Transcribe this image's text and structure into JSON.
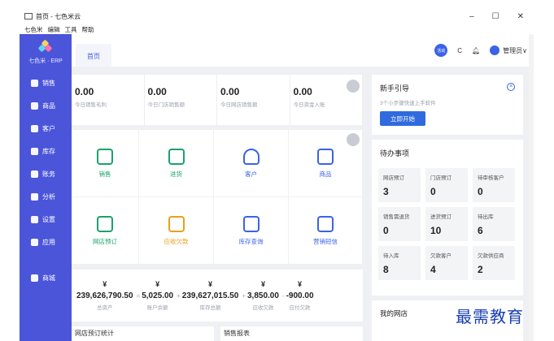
{
  "window": {
    "title": "首页 - 七色米云",
    "minimize": "–",
    "maximize": "☐",
    "close": "✕"
  },
  "menu": [
    "七色米",
    "编辑",
    "工具",
    "帮助"
  ],
  "sidebar": {
    "logo_text": "七色米 · ERP",
    "items": [
      {
        "label": "销售",
        "icon": "sales-icon"
      },
      {
        "label": "商品",
        "icon": "goods-icon"
      },
      {
        "label": "客户",
        "icon": "customer-icon"
      },
      {
        "label": "库存",
        "icon": "inventory-icon"
      },
      {
        "label": "账务",
        "icon": "accounts-icon"
      },
      {
        "label": "分析",
        "icon": "analysis-icon"
      },
      {
        "label": "设置",
        "icon": "settings-icon"
      },
      {
        "label": "应用",
        "icon": "apps-icon"
      }
    ],
    "bottom_item": {
      "label": "商城",
      "icon": "mall-icon"
    }
  },
  "header": {
    "tab_home": "首页",
    "badge": "活动",
    "user": "管理员"
  },
  "stats": [
    {
      "value": "0.00",
      "label": "今日销售毛利"
    },
    {
      "value": "0.00",
      "label": "今日门店销售额"
    },
    {
      "value": "0.00",
      "label": "今日网店销售额"
    },
    {
      "value": "0.00",
      "label": "今日资金入账"
    }
  ],
  "quick_actions": [
    {
      "label": "销售",
      "color": "#1aa26b"
    },
    {
      "label": "进货",
      "color": "#1aa26b"
    },
    {
      "label": "客户",
      "color": "#3b63e6"
    },
    {
      "label": "商品",
      "color": "#3b63e6"
    },
    {
      "label": "网店预订",
      "color": "#1aa26b"
    },
    {
      "label": "应收欠款",
      "color": "#e6a21a"
    },
    {
      "label": "库存查询",
      "color": "#3b63e6"
    },
    {
      "label": "营销短信",
      "color": "#3b63e6"
    }
  ],
  "totals": [
    {
      "yen": "¥",
      "amount": "239,626,790.50",
      "label": "总资产"
    },
    {
      "yen": "¥",
      "amount": "5,025.00",
      "label": "账户余额"
    },
    {
      "yen": "¥",
      "amount": "239,627,015.50",
      "label": "库存总额"
    },
    {
      "yen": "¥",
      "amount": "3,850.00",
      "label": "应收欠款"
    },
    {
      "yen": "¥",
      "amount": "-900.00",
      "label": "应付欠款"
    }
  ],
  "bottom_cards": [
    "网店预订统计",
    "销售报表"
  ],
  "guide": {
    "title": "新手引导",
    "subtitle": "3个小步骤快速上手软件",
    "button": "立即开始"
  },
  "todo": {
    "title": "待办事项",
    "items": [
      {
        "label": "网店预订",
        "value": "3"
      },
      {
        "label": "门店预订",
        "value": "0"
      },
      {
        "label": "待审核客户",
        "value": "0"
      },
      {
        "label": "销售需退货",
        "value": "0"
      },
      {
        "label": "进货预订",
        "value": "10"
      },
      {
        "label": "待出库",
        "value": "6"
      },
      {
        "label": "待入库",
        "value": "8"
      },
      {
        "label": "欠款客户",
        "value": "4"
      },
      {
        "label": "欠款供应商",
        "value": "2"
      }
    ]
  },
  "shop": {
    "title": "我的网店"
  },
  "watermark": "最需教育"
}
